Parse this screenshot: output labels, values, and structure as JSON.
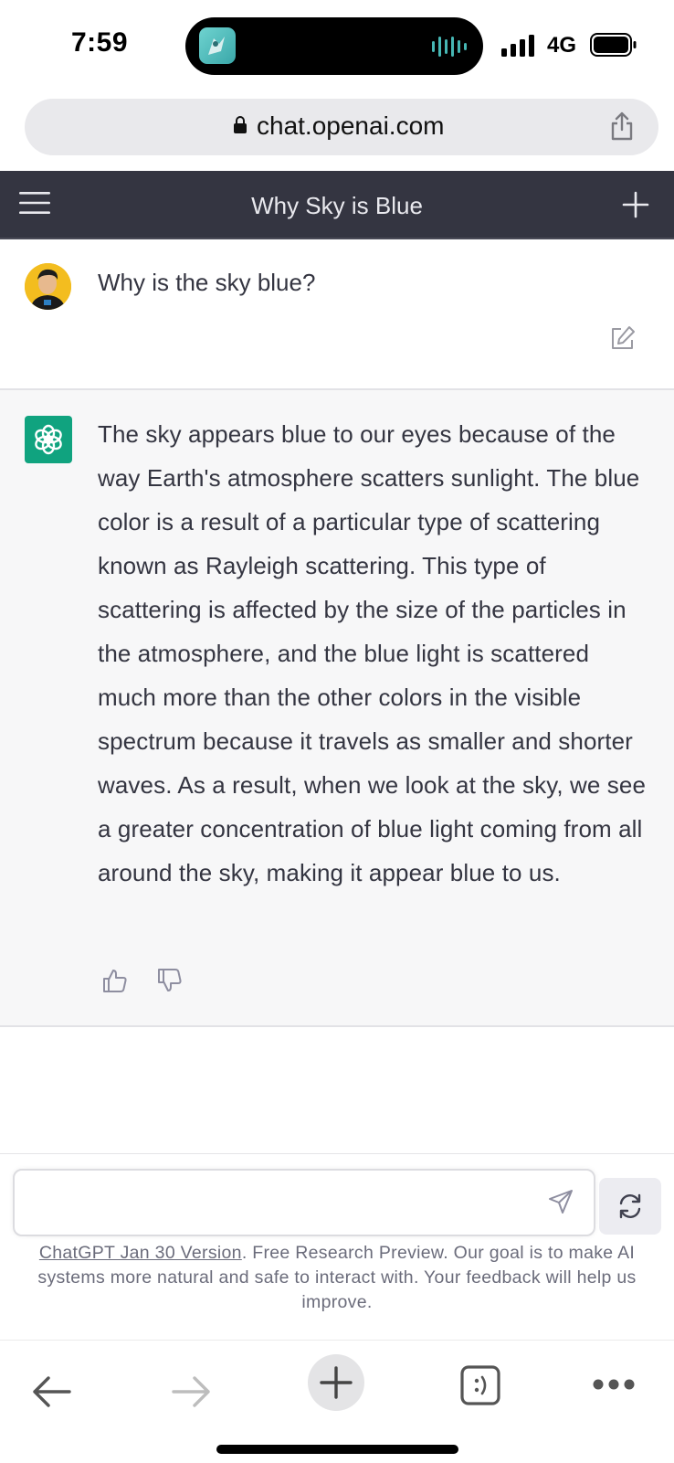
{
  "status_bar": {
    "time": "7:59",
    "network": "4G"
  },
  "browser": {
    "url": "chat.openai.com"
  },
  "header": {
    "title": "Why Sky is Blue"
  },
  "conversation": {
    "user_message": "Why is the sky blue?",
    "assistant_message": "The sky appears blue to our eyes because of the way Earth's atmosphere scatters sunlight. The blue color is a result of a particular type of scattering known as Rayleigh scattering. This type of scattering is affected by the size of the particles in the atmosphere, and the blue light is scattered much more than the other colors in the visible spectrum because it travels as smaller and shorter waves. As a result, when we look at the sky, we see a greater concentration of blue light coming from all around the sky, making it appear blue to us."
  },
  "input": {
    "value": "",
    "placeholder": ""
  },
  "footer": {
    "version_link": "ChatGPT Jan 30 Version",
    "disclaimer": ". Free Research Preview. Our goal is to make AI systems more natural and safe to interact with. Your feedback will help us improve."
  },
  "colors": {
    "header_bg": "#343541",
    "assistant_bg": "#f7f7f8",
    "openai_green": "#10a37f",
    "text": "#343541"
  },
  "icons": {
    "status": [
      "app-icon",
      "waveform-icon",
      "signal-icon",
      "battery-icon"
    ],
    "browser": [
      "lock-icon",
      "share-icon",
      "back-arrow-icon",
      "forward-arrow-icon",
      "new-tab-plus-icon",
      "tabs-icon",
      "more-icon"
    ],
    "chat": [
      "menu-icon",
      "new-chat-plus-icon",
      "edit-icon",
      "openai-logo-icon",
      "thumbs-up-icon",
      "thumbs-down-icon",
      "send-icon",
      "regenerate-icon"
    ]
  }
}
